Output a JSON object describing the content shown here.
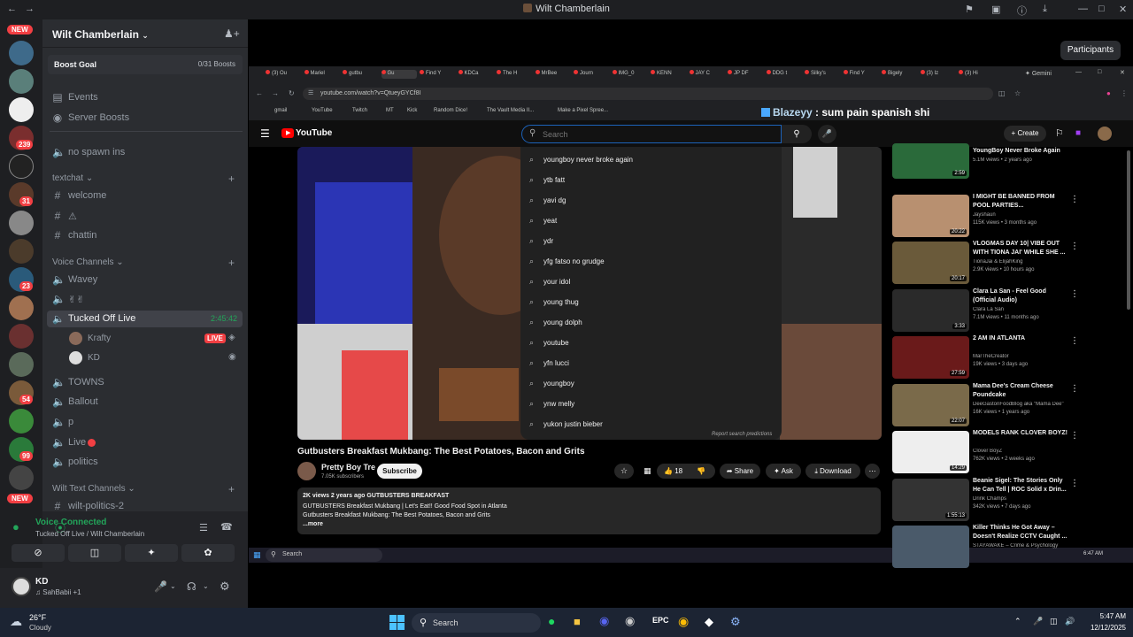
{
  "window": {
    "title": "Wilt Chamberlain",
    "participants_button": "Participants"
  },
  "rail": {
    "badges": [
      "NEW",
      "239",
      "31",
      "23",
      "54",
      "99",
      "NEW"
    ]
  },
  "sidebar": {
    "server_name": "Wilt Chamberlain",
    "boost_goal": "Boost Goal",
    "boost_count": "0/31 Boosts",
    "events": "Events",
    "server_boosts": "Server Boosts",
    "no_spawn": "no spawn ins",
    "textchat_category": "textchat",
    "welcome": "welcome",
    "emoji_channel": "⚠",
    "chattin": "chattin",
    "voice_category": "Voice Channels",
    "wavey": "Wavey",
    "hands_channel": "✌✌",
    "tucked_off": "Tucked Off Live",
    "tucked_time": "2:45:42",
    "member1": "Krafty",
    "live_badge": "LIVE",
    "member2": "KD",
    "towns": "TOWNS",
    "ballout": "Ballout",
    "p": "p",
    "live": "Live",
    "politics": "politics",
    "wilt_text_category": "Wilt Text Channels",
    "wilt_politics": "wilt-politics-2"
  },
  "voice": {
    "status": "Voice Connected",
    "location": "Tucked Off Live / Wilt Chamberlain"
  },
  "user": {
    "name": "KD",
    "status": "SahBabii +1"
  },
  "stream": {
    "tabs": [
      "(3) Ou",
      "Mariel",
      "gutbu",
      "Gu",
      "Find Y",
      "KDCa",
      "The H",
      "MrBee",
      "Journ",
      "IMG_0",
      "KENN",
      "JAY C",
      "JP DF",
      "DDG t",
      "Silky's",
      "Find Y",
      "Bigely",
      "(3) Iz",
      "(3) Hi"
    ],
    "gemini": "Gemini",
    "url": "youtube.com/watch?v=QtueyGYCf8I",
    "bookmarks": [
      "gmail",
      "YouTube",
      "Twitch",
      "MT",
      "Kick",
      "Random Dice!",
      "The Vault Media II...",
      "Make a Pixel Spree..."
    ],
    "chat_user": "Blazeyy",
    "chat_msg": " : sum pain spanish shi",
    "yt_logo": "YouTube",
    "search_placeholder": "Search",
    "create": "Create",
    "suggestions": [
      "youngboy never broke again",
      "ytb fatt",
      "yavi dg",
      "yeat",
      "ydr",
      "yfg fatso no grudge",
      "your idol",
      "young thug",
      "young dolph",
      "youtube",
      "yfn lucci",
      "youngboy",
      "ynw melly",
      "yukon justin bieber"
    ],
    "report": "Report search predictions",
    "video_title": "Gutbusters Breakfast Mukbang: The Best Potatoes, Bacon and Grits",
    "channel": "Pretty Boy Tre",
    "subs": "7.05K subscribers",
    "subscribe": "Subscribe",
    "likes": "18",
    "share": "Share",
    "ask": "Ask",
    "download": "Download",
    "desc_meta": "2K views  2 years ago  GUTBUSTERS BREAKFAST",
    "desc_line1": "GUTBUSTERS Breakfast  Mukbang | Let's Eat!! Good Food Spot in Atlanta",
    "desc_line2": "Gutbusters Breakfast Mukbang: The Best Potatoes, Bacon and Grits",
    "more": "...more",
    "related": [
      {
        "title": "YoungBoy Never Broke Again",
        "line2": "5.1M views • 2 years ago",
        "dur": "2:59"
      },
      {
        "title": "I MIGHT BE BANNED FROM POOL PARTIES...",
        "line2": "Jayshaun",
        "line3": "115K views • 3 months ago",
        "dur": "20:22"
      },
      {
        "title": "VLOGMAS DAY 10| VIBE OUT WITH TIONA JAI' WHILE SHE ...",
        "line2": "TionaJai & ElijahKing",
        "line3": "2.9K views • 10 hours ago",
        "dur": "20:17"
      },
      {
        "title": "Clara La San - Feel Good (Official Audio)",
        "line2": "Clara La San",
        "line3": "7.1M views • 11 months ago",
        "dur": "3:33"
      },
      {
        "title": "2 AM IN ATLANTA",
        "line2": "MarTheCreator",
        "line3": "19K views • 3 days ago",
        "dur": "27:59"
      },
      {
        "title": "Mama Dee's Cream Cheese Poundcake",
        "line2": "DeeGastonFoodBlog aka \"Mama Dee\"",
        "line3": "16K views • 1 years ago",
        "dur": "22:07"
      },
      {
        "title": "MODELS RANK CLOVER BOYZ!",
        "line2": "Clover BoyZ",
        "line3": "762K views • 2 weeks ago",
        "dur": "14:29"
      },
      {
        "title": "Beanie Sigel: The Stories Only He Can Tell | ROC Solid x Drin...",
        "line2": "Drink Champs",
        "line3": "342K views • 7 days ago",
        "dur": "1:55:13"
      },
      {
        "title": "Killer Thinks He Got Away – Doesn't Realize CCTV Caught ...",
        "line2": "STAYAWAKE – Crime & Psychology",
        "dur": ""
      }
    ],
    "inner_search": "Search",
    "inner_time": "6:47 AM"
  },
  "taskbar": {
    "temp": "26°F",
    "weather": "Cloudy",
    "search": "Search",
    "time": "5:47 AM",
    "date": "12/12/2025"
  }
}
